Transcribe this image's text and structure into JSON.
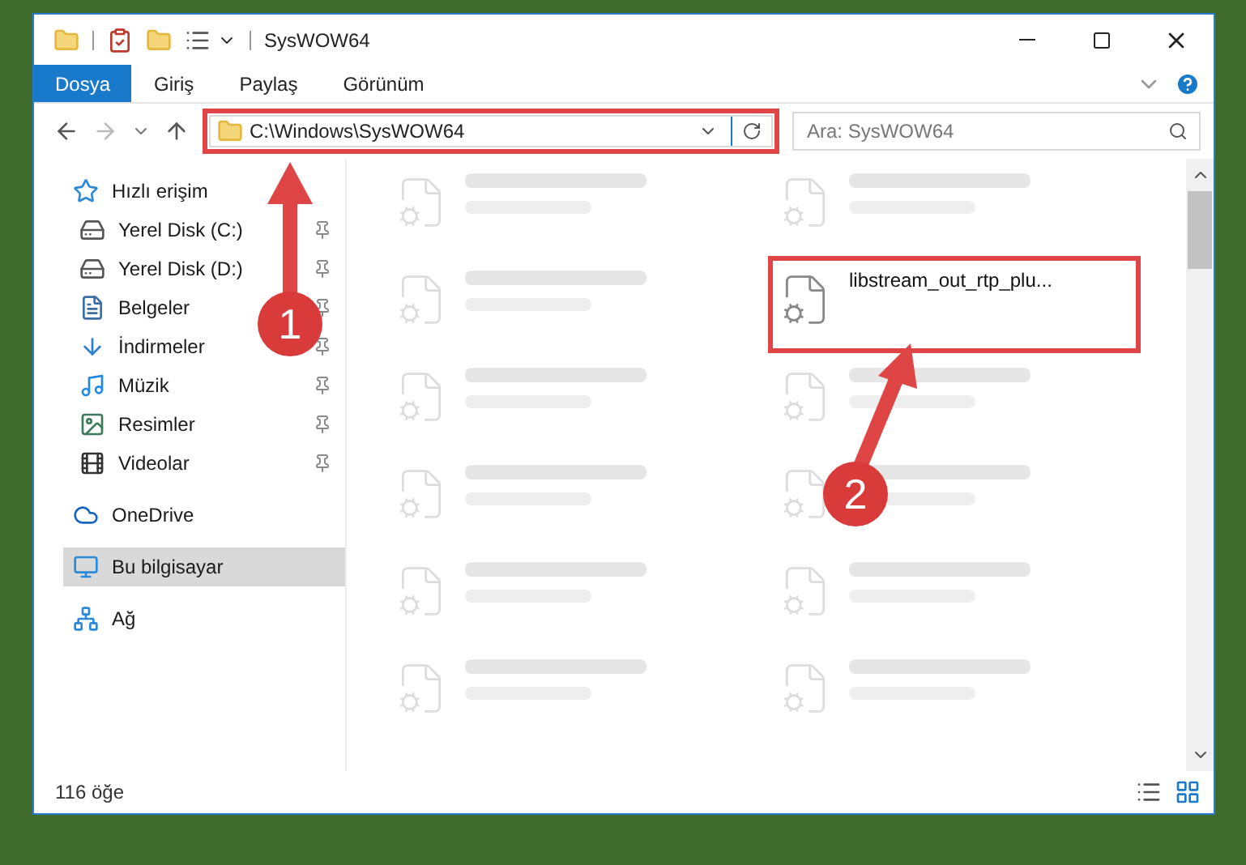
{
  "window": {
    "title": "SysWOW64"
  },
  "ribbon_tabs": [
    {
      "label": "Dosya",
      "kind": "file_menu"
    },
    {
      "label": "Giriş",
      "kind": "tab"
    },
    {
      "label": "Paylaş",
      "kind": "tab"
    },
    {
      "label": "Görünüm",
      "kind": "tab"
    }
  ],
  "address": {
    "value": "C:\\Windows\\SysWOW64"
  },
  "search": {
    "placeholder": "Ara: SysWOW64"
  },
  "sidebar": {
    "items": [
      {
        "label": "Hızlı erişim",
        "kind": "quick",
        "selected": false,
        "children": [
          {
            "label": "Yerel Disk (C:)",
            "kind": "disk_c",
            "pinned": true
          },
          {
            "label": "Yerel Disk (D:)",
            "kind": "disk",
            "pinned": true
          },
          {
            "label": "Belgeler",
            "kind": "docs",
            "pinned": true
          },
          {
            "label": "İndirmeler",
            "kind": "downloads",
            "pinned": true
          },
          {
            "label": "Müzik",
            "kind": "music",
            "pinned": true
          },
          {
            "label": "Resimler",
            "kind": "pictures",
            "pinned": true
          },
          {
            "label": "Videolar",
            "kind": "videos",
            "pinned": true
          }
        ]
      },
      {
        "label": "OneDrive",
        "kind": "cloud",
        "selected": false
      },
      {
        "label": "Bu bilgisayar",
        "kind": "pc",
        "selected": true
      },
      {
        "label": "Ağ",
        "kind": "network",
        "selected": false
      }
    ]
  },
  "files": [
    {
      "blurred": true
    },
    {
      "blurred": true
    },
    {
      "blurred": true
    },
    {
      "name": "libstream_out_rtp_plu...",
      "blurred": false
    },
    {
      "blurred": true
    },
    {
      "blurred": true
    },
    {
      "blurred": true
    },
    {
      "blurred": true
    },
    {
      "blurred": true
    },
    {
      "blurred": true
    },
    {
      "blurred": true
    },
    {
      "blurred": true
    }
  ],
  "status_bar": {
    "count": "116 öğe"
  },
  "annotations": [
    {
      "label": "1"
    },
    {
      "label": "2"
    }
  ]
}
